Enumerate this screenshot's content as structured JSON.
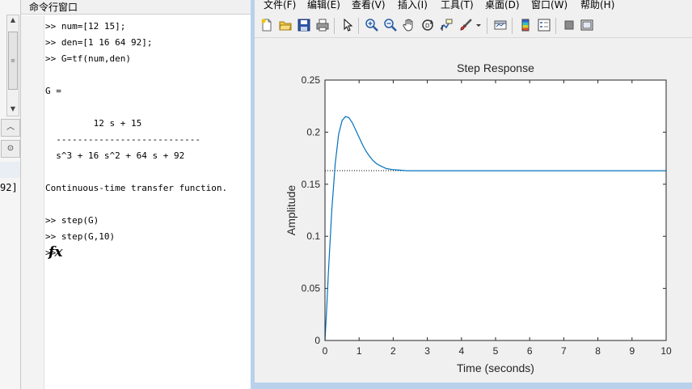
{
  "left_strip": {
    "partial_text": "92]",
    "icons": [
      "scroll-up-arrow",
      "scroll-down-arrow",
      "grip-icon",
      "chevron-up-icon",
      "dropdown-icon"
    ]
  },
  "command_window": {
    "title": "命令行窗口",
    "lines": [
      ">> num=[12 15];",
      ">> den=[1 16 64 92];",
      ">> G=tf(num,den)",
      "",
      "G =",
      "",
      "         12 s + 15",
      "  ---------------------------",
      "  s^3 + 16 s^2 + 64 s + 92",
      "",
      "Continuous-time transfer function.",
      "",
      ">> step(G)",
      ">> step(G,10)",
      ">>"
    ],
    "fx_label": "fx"
  },
  "figure_window": {
    "menu": [
      "文件(F)",
      "编辑(E)",
      "查看(V)",
      "插入(I)",
      "工具(T)",
      "桌面(D)",
      "窗口(W)",
      "帮助(H)"
    ],
    "toolbar": [
      "new-figure-icon",
      "open-file-icon",
      "save-icon",
      "print-icon",
      "pointer-icon",
      "zoom-in-icon",
      "zoom-out-icon",
      "pan-hand-icon",
      "rotate-3d-icon",
      "data-cursor-icon",
      "brush-icon",
      "link-plot-icon",
      "colorbar-icon",
      "legend-icon",
      "hide-plot-tools-icon",
      "show-plot-tools-icon"
    ]
  },
  "chart_data": {
    "type": "line",
    "title": "Step Response",
    "xlabel": "Time (seconds)",
    "ylabel": "Amplitude",
    "xlim": [
      0,
      10
    ],
    "ylim": [
      0,
      0.25
    ],
    "xticks": [
      0,
      1,
      2,
      3,
      4,
      5,
      6,
      7,
      8,
      9,
      10
    ],
    "yticks": [
      0,
      0.05,
      0.1,
      0.15,
      0.2,
      0.25
    ],
    "ytick_labels": [
      "0",
      "0.05",
      "0.1",
      "0.15",
      "0.2",
      "0.25"
    ],
    "steady_state": 0.163,
    "series": [
      {
        "color": "#0072bd",
        "x": [
          0,
          0.05,
          0.1,
          0.2,
          0.3,
          0.4,
          0.5,
          0.6,
          0.7,
          0.8,
          0.9,
          1.0,
          1.1,
          1.2,
          1.3,
          1.4,
          1.5,
          1.6,
          1.8,
          2.0,
          2.2,
          2.4,
          2.6,
          3.0,
          4.0,
          5.0,
          6.0,
          7.0,
          8.0,
          9.0,
          10.0
        ],
        "y": [
          0,
          0.03,
          0.065,
          0.125,
          0.17,
          0.198,
          0.211,
          0.215,
          0.214,
          0.209,
          0.202,
          0.195,
          0.188,
          0.182,
          0.177,
          0.173,
          0.17,
          0.168,
          0.165,
          0.164,
          0.1635,
          0.163,
          0.163,
          0.163,
          0.163,
          0.163,
          0.163,
          0.163,
          0.163,
          0.163,
          0.163
        ]
      }
    ]
  }
}
